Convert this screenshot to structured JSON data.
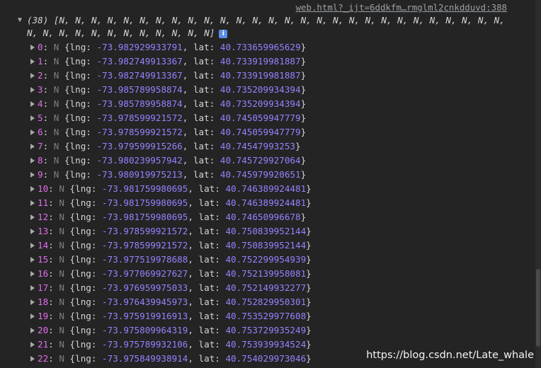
{
  "source_link": "web.html?_ijt=6ddkfm…rmglml2cnkdduvd:388",
  "summary": {
    "toggle_glyph": "▼",
    "line1": "(38) [N, N, N, N, N, N, N, N, N, N, N, N, N, N, N, N, N, N, N, N, N, N, N, N, N, N, N, N,",
    "line2": "N, N, N, N, N, N, N, N, N, N, N, N]",
    "info_badge": "i"
  },
  "rows": [
    {
      "index": "0",
      "type": "N",
      "lng": "-73.982929933791",
      "lat": "40.733659965629"
    },
    {
      "index": "1",
      "type": "N",
      "lng": "-73.982749913367",
      "lat": "40.733919981887"
    },
    {
      "index": "2",
      "type": "N",
      "lng": "-73.982749913367",
      "lat": "40.733919981887"
    },
    {
      "index": "3",
      "type": "N",
      "lng": "-73.985789958874",
      "lat": "40.735209934394"
    },
    {
      "index": "4",
      "type": "N",
      "lng": "-73.985789958874",
      "lat": "40.735209934394"
    },
    {
      "index": "5",
      "type": "N",
      "lng": "-73.978599921572",
      "lat": "40.745059947779"
    },
    {
      "index": "6",
      "type": "N",
      "lng": "-73.978599921572",
      "lat": "40.745059947779"
    },
    {
      "index": "7",
      "type": "N",
      "lng": "-73.979599915266",
      "lat": "40.74547993253"
    },
    {
      "index": "8",
      "type": "N",
      "lng": "-73.980239957942",
      "lat": "40.745729927064"
    },
    {
      "index": "9",
      "type": "N",
      "lng": "-73.980919975213",
      "lat": "40.745979920651"
    },
    {
      "index": "10",
      "type": "N",
      "lng": "-73.981759980695",
      "lat": "40.746389924481"
    },
    {
      "index": "11",
      "type": "N",
      "lng": "-73.981759980695",
      "lat": "40.746389924481"
    },
    {
      "index": "12",
      "type": "N",
      "lng": "-73.981759980695",
      "lat": "40.74650996678"
    },
    {
      "index": "13",
      "type": "N",
      "lng": "-73.978599921572",
      "lat": "40.750839952144"
    },
    {
      "index": "14",
      "type": "N",
      "lng": "-73.978599921572",
      "lat": "40.750839952144"
    },
    {
      "index": "15",
      "type": "N",
      "lng": "-73.977519978688",
      "lat": "40.752299954939"
    },
    {
      "index": "16",
      "type": "N",
      "lng": "-73.977069927627",
      "lat": "40.752139958081"
    },
    {
      "index": "17",
      "type": "N",
      "lng": "-73.976959975033",
      "lat": "40.752149932277"
    },
    {
      "index": "18",
      "type": "N",
      "lng": "-73.976439945973",
      "lat": "40.752829950301"
    },
    {
      "index": "19",
      "type": "N",
      "lng": "-73.975919916913",
      "lat": "40.753529977608"
    },
    {
      "index": "20",
      "type": "N",
      "lng": "-73.975809964319",
      "lat": "40.753729935249"
    },
    {
      "index": "21",
      "type": "N",
      "lng": "-73.975789932106",
      "lat": "40.753939934524"
    },
    {
      "index": "22",
      "type": "N",
      "lng": "-73.975849938914",
      "lat": "40.754029973046"
    }
  ],
  "labels": {
    "lng_key": "lng: ",
    "lat_key": ", lat: ",
    "open_brace": " {",
    "close_brace": "}",
    "colon": ": "
  },
  "watermark": "https://blog.csdn.net/Late_whale",
  "colors": {
    "background": "#242424",
    "index": "#e36eec",
    "number": "#9980ff",
    "type": "#7f7f7f",
    "text": "#d5d5d5"
  }
}
